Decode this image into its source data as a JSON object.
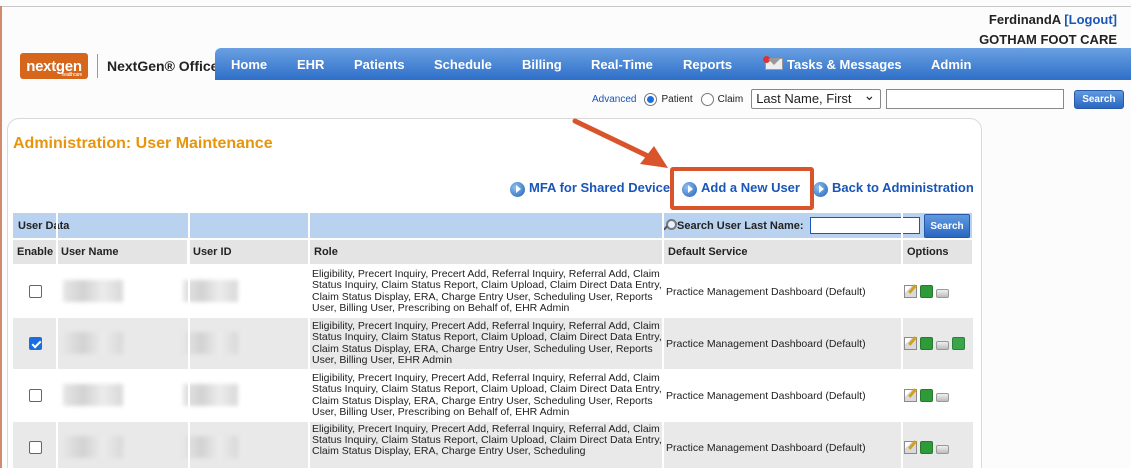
{
  "user": {
    "name": "FerdinandA",
    "logout": "[Logout]",
    "practice": "GOTHAM FOOT CARE"
  },
  "logo": {
    "mark": "nextgen",
    "tagline": "healthcare",
    "product": "NextGen® Office"
  },
  "nav": [
    "Home",
    "EHR",
    "Patients",
    "Schedule",
    "Billing",
    "Real-Time",
    "Reports",
    "Tasks & Messages",
    "Admin"
  ],
  "search": {
    "advanced": "Advanced",
    "patient_label": "Patient",
    "claim_label": "Claim",
    "selected": "patient",
    "select_value": "Last Name, First",
    "button": "Search"
  },
  "page": {
    "title": "Administration: User Maintenance",
    "links": {
      "mfa": "MFA for Shared Device",
      "add_user": "Add a New User",
      "back": "Back to Administration"
    }
  },
  "grid": {
    "section_label": "User Data",
    "search_last_label": "Search User Last Name:",
    "search_button": "Search",
    "columns": [
      "Enable",
      "User Name",
      "User ID",
      "Role",
      "Default Service",
      "Options"
    ],
    "rows": [
      {
        "enabled": false,
        "role": "Eligibility, Precert Inquiry, Precert Add, Referral Inquiry, Referral Add, Claim Status Inquiry, Claim Status Report, Claim Upload, Claim Direct Data Entry, Claim Status Display, ERA, Charge Entry User, Scheduling User, Reports User, Billing User, Prescribing on Behalf of, EHR Admin",
        "service": "Practice Management Dashboard (Default)"
      },
      {
        "enabled": true,
        "role": "Eligibility, Precert Inquiry, Precert Add, Referral Inquiry, Referral Add, Claim Status Inquiry, Claim Status Report, Claim Upload, Claim Direct Data Entry, Claim Status Display, ERA, Charge Entry User, Scheduling User, Reports User, Billing User, EHR Admin",
        "service": "Practice Management Dashboard (Default)"
      },
      {
        "enabled": false,
        "role": "Eligibility, Precert Inquiry, Precert Add, Referral Inquiry, Referral Add, Claim Status Inquiry, Claim Status Report, Claim Upload, Claim Direct Data Entry, Claim Status Display, ERA, Charge Entry User, Scheduling User, Reports User, Billing User, Prescribing on Behalf of, EHR Admin",
        "service": "Practice Management Dashboard (Default)"
      },
      {
        "enabled": false,
        "role": "Eligibility, Precert Inquiry, Precert Add, Referral Inquiry, Referral Add, Claim Status Inquiry, Claim Status Report, Claim Upload, Claim Direct Data Entry, Claim Status Display, ERA, Charge Entry User, Scheduling",
        "service": "Practice Management Dashboard (Default)"
      }
    ]
  },
  "colors": {
    "nav": "#2e6fc8",
    "title": "#e8950e",
    "link": "#1a55b8",
    "highlight": "#d9542b",
    "grid_header": "#b9d2f0"
  }
}
